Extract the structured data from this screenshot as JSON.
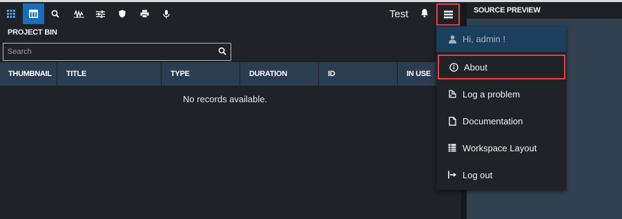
{
  "toolbar": {
    "title": "Test",
    "icons": [
      "grid-icon",
      "panel-icon",
      "search-icon",
      "waveform-icon",
      "sliders-icon",
      "shield-icon",
      "printer-icon",
      "microphone-icon"
    ]
  },
  "project_bin": {
    "title": "PROJECT BIN",
    "search_placeholder": "Search",
    "columns": [
      "THUMBNAIL",
      "TITLE",
      "TYPE",
      "DURATION",
      "ID",
      "IN USE"
    ],
    "empty_message": "No records available."
  },
  "preview": {
    "title": "SOURCE PREVIEW"
  },
  "menu": {
    "greeting": "Hi, admin !",
    "items": [
      {
        "label": "About",
        "icon": "info-icon"
      },
      {
        "label": "Log a problem",
        "icon": "bug-icon"
      },
      {
        "label": "Documentation",
        "icon": "document-icon"
      },
      {
        "label": "Workspace Layout",
        "icon": "layout-icon"
      },
      {
        "label": "Log out",
        "icon": "logout-icon"
      }
    ]
  },
  "colors": {
    "accent": "#1a6cbc",
    "highlight": "#e2414a",
    "header_bg": "#2b3d50",
    "greeting_bg": "#1c3f5e"
  }
}
